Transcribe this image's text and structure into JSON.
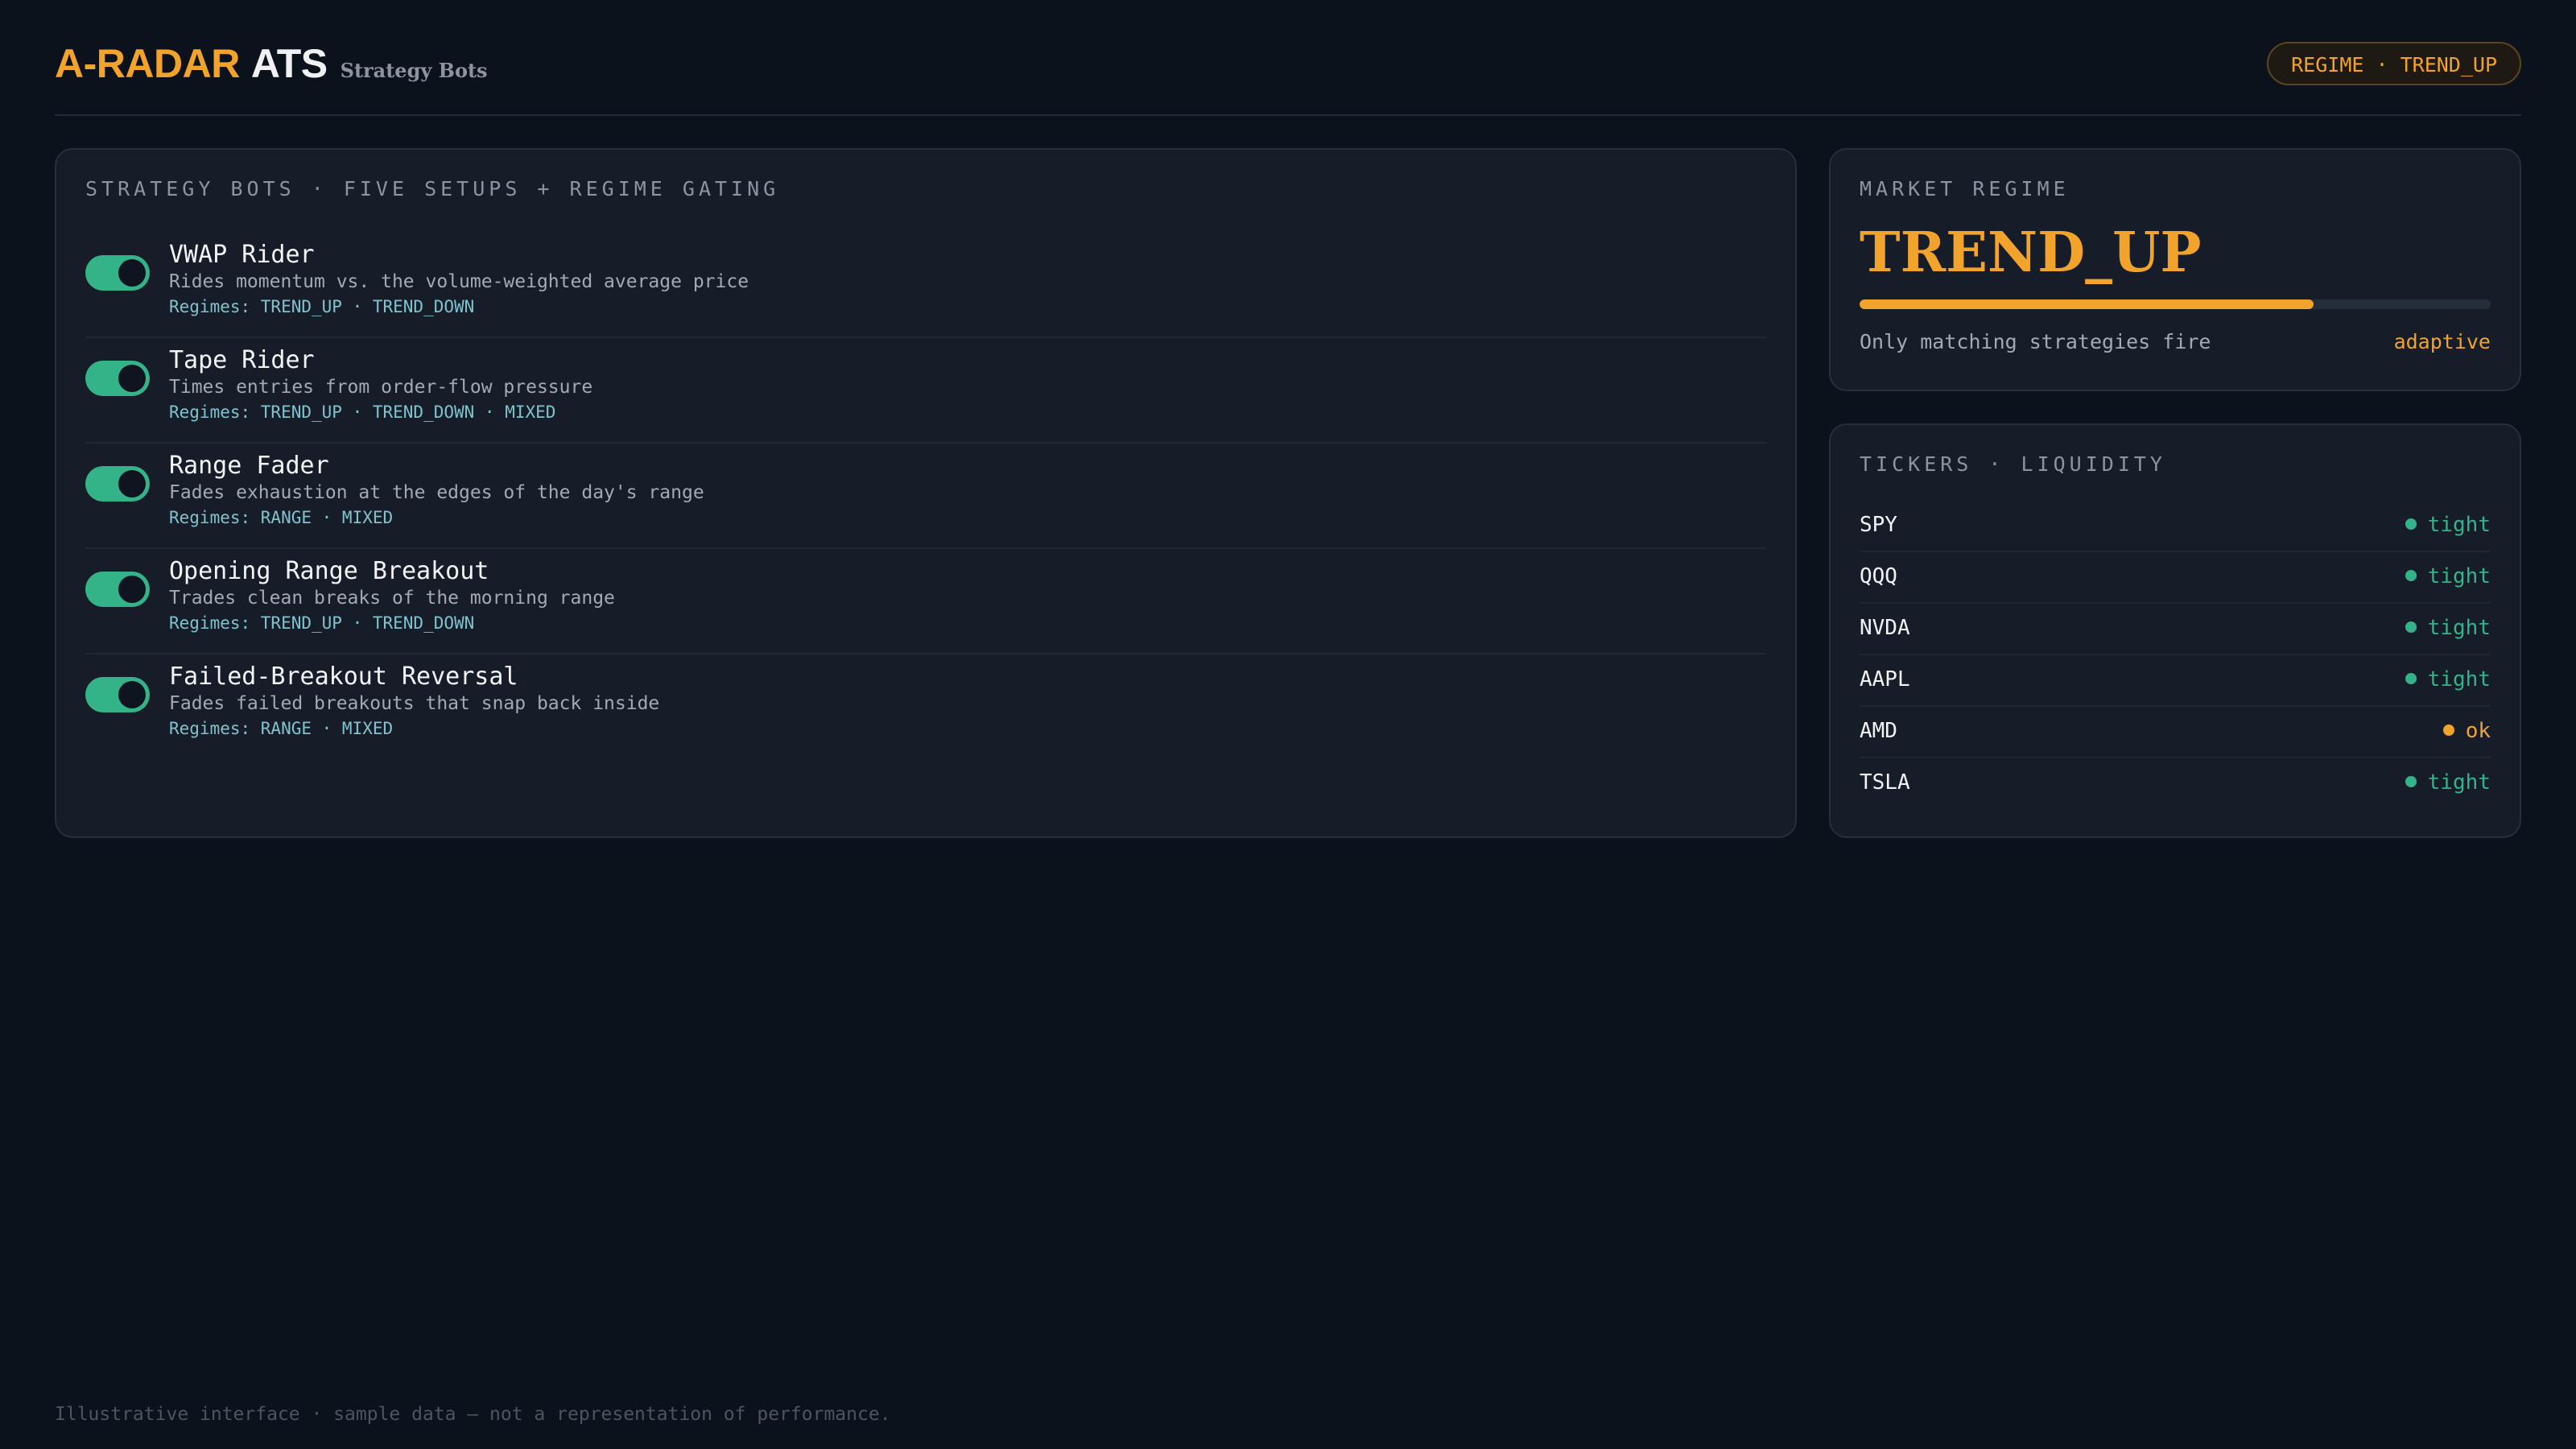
{
  "header": {
    "brand_primary": "A-RADAR",
    "brand_secondary": "ATS",
    "subtitle": "Strategy Bots",
    "regime_pill": "REGIME · TREND_UP"
  },
  "colors": {
    "accent": "#f2a32b",
    "toggle_on": "#34b389",
    "status_tight": "#34b389",
    "status_ok": "#f2a32b",
    "regime_text": "#7fc3cf"
  },
  "bots": {
    "title": "STRATEGY BOTS · FIVE SETUPS + REGIME GATING",
    "items": [
      {
        "name": "VWAP Rider",
        "description": "Rides momentum vs. the volume-weighted average price",
        "regimes": "Regimes: TREND_UP · TREND_DOWN",
        "enabled": true
      },
      {
        "name": "Tape Rider",
        "description": "Times entries from order-flow pressure",
        "regimes": "Regimes: TREND_UP · TREND_DOWN · MIXED",
        "enabled": true
      },
      {
        "name": "Range Fader",
        "description": "Fades exhaustion at the edges of the day's range",
        "regimes": "Regimes: RANGE · MIXED",
        "enabled": true
      },
      {
        "name": "Opening Range Breakout",
        "description": "Trades clean breaks of the morning range",
        "regimes": "Regimes: TREND_UP · TREND_DOWN",
        "enabled": true
      },
      {
        "name": "Failed-Breakout Reversal",
        "description": "Fades failed breakouts that snap back inside",
        "regimes": "Regimes: RANGE · MIXED",
        "enabled": true
      }
    ]
  },
  "regime": {
    "title": "MARKET REGIME",
    "value": "TREND_UP",
    "confidence": 0.72,
    "note": "Only matching strategies fire",
    "tag": "adaptive"
  },
  "tickers": {
    "title": "TICKERS · LIQUIDITY",
    "rows": [
      {
        "symbol": "SPY",
        "status": "tight"
      },
      {
        "symbol": "QQQ",
        "status": "tight"
      },
      {
        "symbol": "NVDA",
        "status": "tight"
      },
      {
        "symbol": "AAPL",
        "status": "tight"
      },
      {
        "symbol": "AMD",
        "status": "ok"
      },
      {
        "symbol": "TSLA",
        "status": "tight"
      }
    ]
  },
  "footer": "Illustrative interface · sample data — not a representation of performance."
}
